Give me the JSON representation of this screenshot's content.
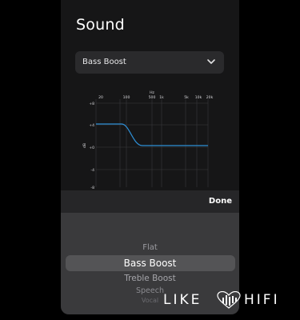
{
  "screen": {
    "title": "Sound"
  },
  "dropdown": {
    "value": "Bass Boost",
    "icon": "chevron-down-icon"
  },
  "eq_graph": {
    "unit_label": "Hz",
    "x_ticks": [
      "20",
      "100",
      "500",
      "1k",
      "5k",
      "10k",
      "20k"
    ],
    "y_ticks": [
      "+8",
      "+4",
      "+0",
      "-4",
      "-8"
    ],
    "y_axis_label": "dB",
    "curve_color": "#2e8fd6"
  },
  "toolbar": {
    "done_label": "Done"
  },
  "picker": {
    "options": [
      "Flat",
      "Bass Boost",
      "Treble Boost",
      "Speech",
      "Vocal"
    ],
    "selected": "Bass Boost"
  },
  "watermark": {
    "left_text": "LIKE",
    "right_text": "HIFI"
  }
}
